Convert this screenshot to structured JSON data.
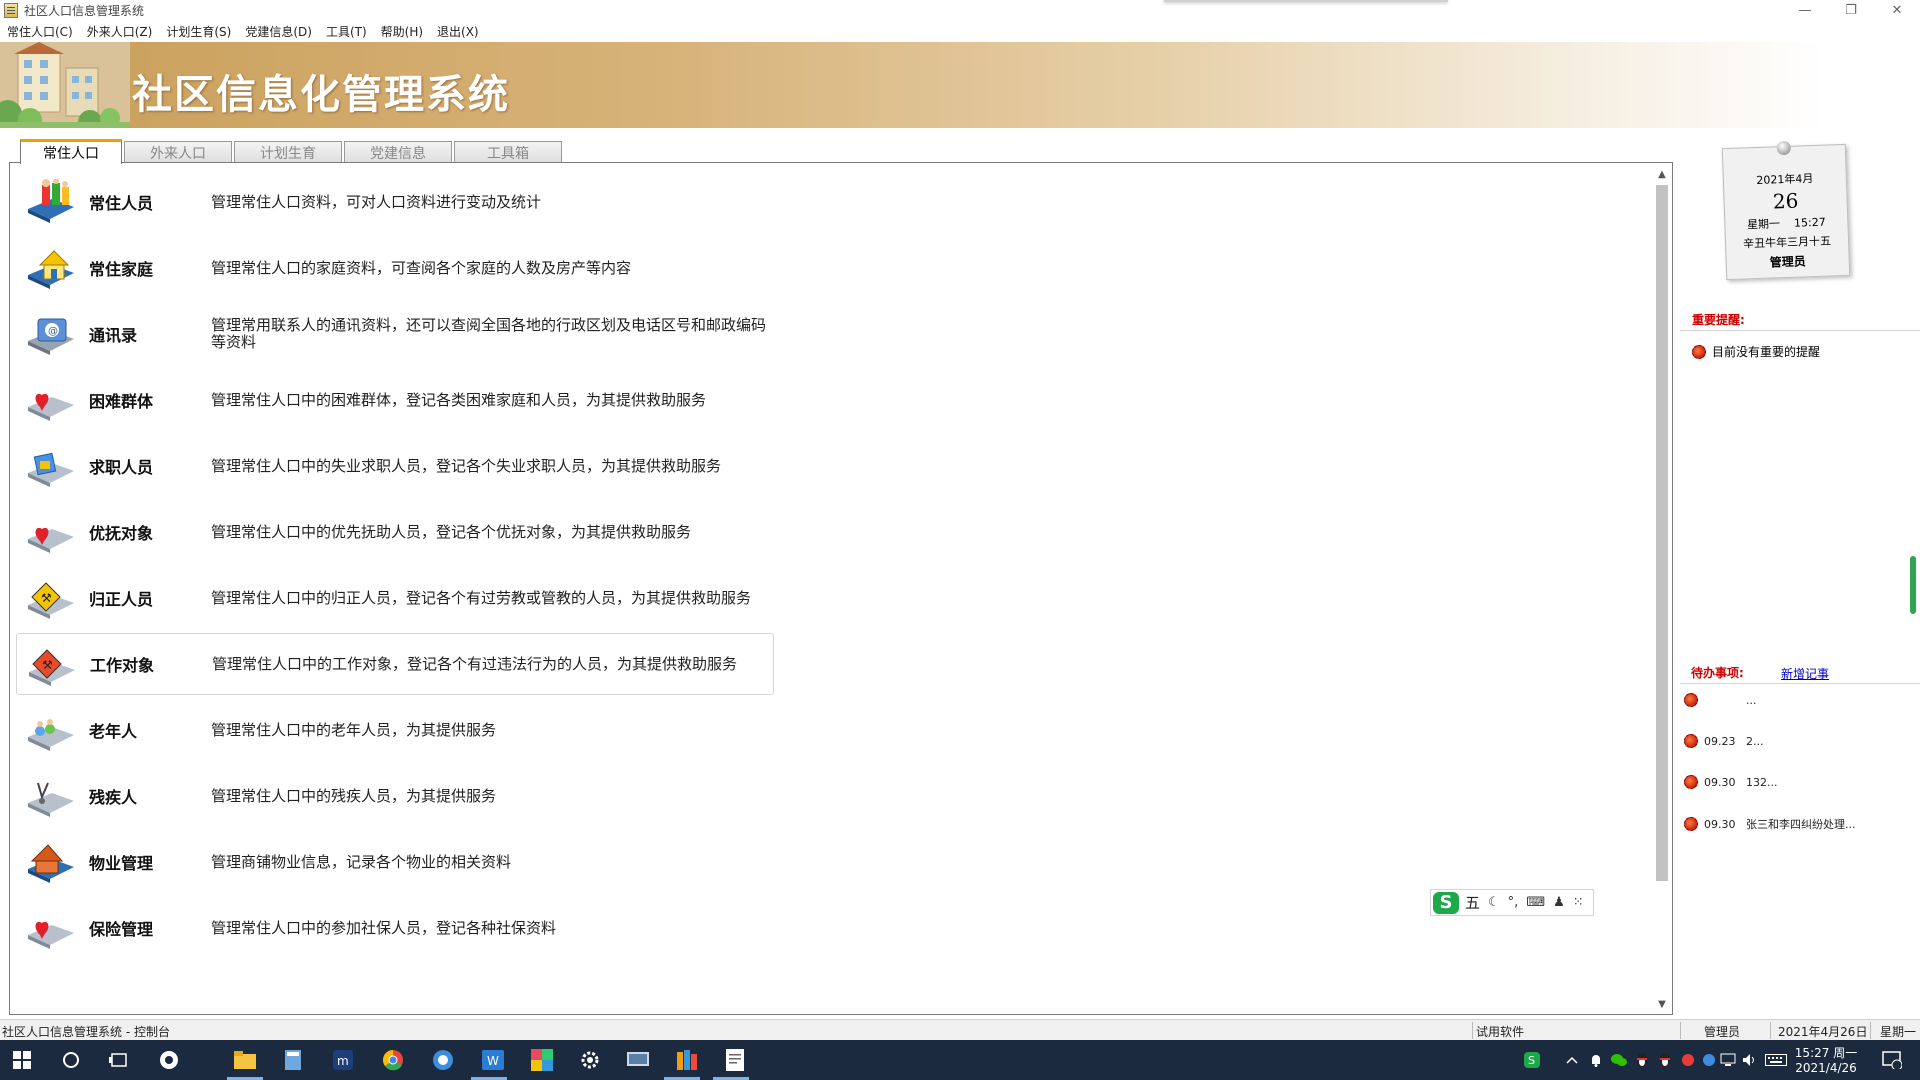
{
  "window": {
    "title": "社区人口信息管理系统",
    "controls": {
      "minimize": "—",
      "restore": "❐",
      "close": "✕"
    }
  },
  "menu": [
    "常住人口(C)",
    "外来人口(Z)",
    "计划生育(S)",
    "党建信息(D)",
    "工具(T)",
    "帮助(H)",
    "退出(X)"
  ],
  "banner": {
    "title": "社区信息化管理系统"
  },
  "tabs": [
    "常住人口",
    "外来人口",
    "计划生育",
    "党建信息",
    "工具箱"
  ],
  "active_tab": "常住人口",
  "items": [
    {
      "name": "常住人员",
      "desc": "管理常住人口资料，可对人口资料进行变动及统计",
      "icon": "people-book-icon"
    },
    {
      "name": "常住家庭",
      "desc": "管理常住人口的家庭资料，可查阅各个家庭的人数及房产等内容",
      "icon": "house-book-icon"
    },
    {
      "name": "通讯录",
      "desc": "管理常用联系人的通讯资料，还可以查阅全国各地的行政区划及电话区号和邮政编码等资料",
      "icon": "address-book-icon"
    },
    {
      "name": "困难群体",
      "desc": "管理常住人口中的困难群体，登记各类困难家庭和人员，为其提供救助服务",
      "icon": "heart-book-icon"
    },
    {
      "name": "求职人员",
      "desc": "管理常住人口中的失业求职人员，登记各个失业求职人员，为其提供救助服务",
      "icon": "job-book-icon"
    },
    {
      "name": "优抚对象",
      "desc": "管理常住人口中的优先抚助人员，登记各个优抚对象，为其提供救助服务",
      "icon": "heart-book-icon"
    },
    {
      "name": "归正人员",
      "desc": "管理常住人口中的归正人员，登记各个有过劳教或管教的人员，为其提供救助服务",
      "icon": "yellow-sign-book-icon"
    },
    {
      "name": "工作对象",
      "desc": "管理常住人口中的工作对象，登记各个有过违法行为的人员，为其提供救助服务",
      "icon": "red-sign-book-icon"
    },
    {
      "name": "老年人",
      "desc": "管理常住人口中的老年人员，为其提供服务",
      "icon": "elderly-book-icon"
    },
    {
      "name": "残疾人",
      "desc": "管理常住人口中的残疾人员，为其提供服务",
      "icon": "stethoscope-book-icon"
    },
    {
      "name": "物业管理",
      "desc": "管理商铺物业信息，记录各个物业的相关资料",
      "icon": "property-book-icon"
    },
    {
      "name": "保险管理",
      "desc": "管理常住人口中的参加社保人员，登记各种社保资料",
      "icon": "heart-book-icon"
    }
  ],
  "ime": {
    "mode": "五"
  },
  "calendar": {
    "month": "2021年4月",
    "day": "26",
    "weekday": "星期一",
    "time": "15:27",
    "lunar": "辛丑牛年三月十五",
    "user": "管理员"
  },
  "reminders": {
    "label": "重要提醒:",
    "items": [
      "目前没有重要的提醒"
    ]
  },
  "todo": {
    "label": "待办事项:",
    "new_link": "新增记事",
    "items": [
      {
        "date": "",
        "text": "..."
      },
      {
        "date": "09.23",
        "text": "2..."
      },
      {
        "date": "09.30",
        "text": "132..."
      },
      {
        "date": "09.30",
        "text": "张三和李四纠纷处理..."
      }
    ]
  },
  "status": {
    "left": "社区人口信息管理系统 - 控制台",
    "license": "试用软件",
    "user": "管理员",
    "date": "2021年4月26日",
    "weekday": "星期一"
  },
  "taskbar": {
    "time": "15:27 周一",
    "date": "2021/4/26"
  }
}
